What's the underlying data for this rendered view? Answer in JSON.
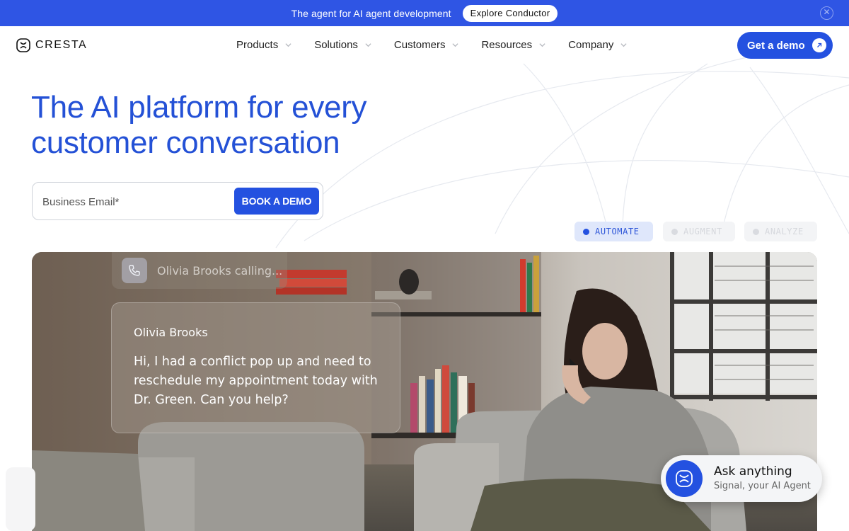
{
  "announcement": {
    "text": "The agent for AI agent development",
    "button": "Explore Conductor",
    "close_icon": "close-icon"
  },
  "nav": {
    "logo_text": "CRESTA",
    "menu": [
      {
        "label": "Products",
        "icon": "chevron-down-icon"
      },
      {
        "label": "Solutions",
        "icon": "chevron-down-icon"
      },
      {
        "label": "Customers",
        "icon": "chevron-down-icon"
      },
      {
        "label": "Resources",
        "icon": "chevron-down-icon"
      },
      {
        "label": "Company",
        "icon": "chevron-down-icon"
      }
    ],
    "cta": "Get a demo",
    "cta_icon": "arrow-up-right-icon"
  },
  "hero": {
    "title_line1": "The AI platform for every",
    "title_line2": "customer conversation",
    "email_placeholder": "Business Email*",
    "email_value": "",
    "book_button": "BOOK A DEMO"
  },
  "modes": [
    {
      "label": "AUTOMATE",
      "active": true
    },
    {
      "label": "AUGMENT",
      "active": false
    },
    {
      "label": "ANALYZE",
      "active": false
    }
  ],
  "video": {
    "call_label": "Olivia Brooks calling...",
    "call_icon": "phone-icon",
    "message_name": "Olivia Brooks",
    "message_text": "Hi, I had a conflict pop up and need to reschedule my appointment today with Dr. Green. Can you help?"
  },
  "assistant": {
    "title": "Ask anything",
    "subtitle": "Signal, your AI Agent",
    "icon": "signal-agent-icon"
  },
  "colors": {
    "brand_blue": "#2451e0",
    "announce_blue": "#2f55e4",
    "title_blue": "#2451d6"
  }
}
